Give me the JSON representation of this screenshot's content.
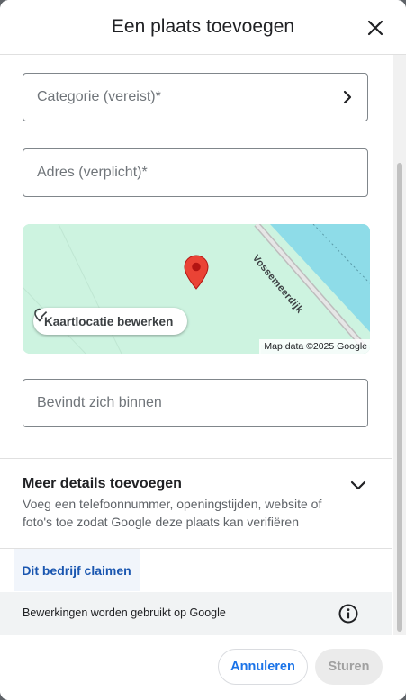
{
  "dialog": {
    "title": "Een plaats toevoegen",
    "close_icon": "close-icon"
  },
  "form": {
    "category_placeholder": "Categorie (vereist)*",
    "address_placeholder": "Adres (verplicht)*",
    "within_placeholder": "Bevindt zich binnen"
  },
  "map": {
    "street_label": "Vossemeerdijk",
    "edit_button_label": "Kaartlocatie bewerken",
    "attribution": "Map data ©2025 Google",
    "pin_icon": "map-pin-icon",
    "edit_icon": "edit-location-icon",
    "colors": {
      "land": "#cdf3e0",
      "water": "#8edce8",
      "road": "#c8c8c8",
      "pin": "#ea4335"
    }
  },
  "details": {
    "title": "Meer details toevoegen",
    "description": "Voeg een telefoonnummer, openingstijden, website of foto's toe zodat Google deze plaats kan verifiëren",
    "expand_icon": "chevron-down-icon"
  },
  "claim": {
    "label": "Dit bedrijf claimen"
  },
  "notice": {
    "text": "Bewerkingen worden gebruikt op Google",
    "info_icon": "info-icon"
  },
  "footer": {
    "cancel_label": "Annuleren",
    "send_label": "Sturen"
  },
  "colors": {
    "accent": "#1a73e8",
    "claim_text": "#1a56b0",
    "disabled_bg": "#ebebeb"
  }
}
